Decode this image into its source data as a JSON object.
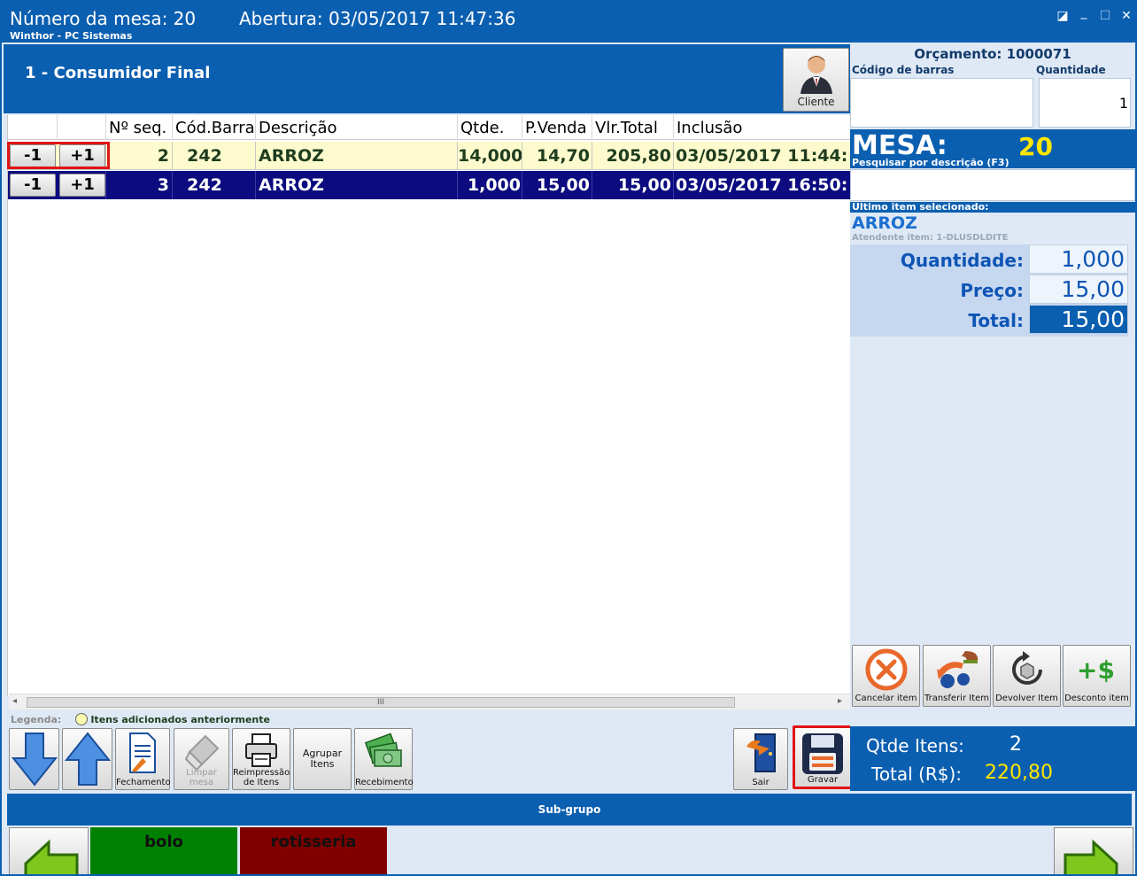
{
  "window": {
    "mesa_title": "Número da mesa: 20",
    "abertura": "Abertura: 03/05/2017 11:47:36",
    "app_name": "Winthor - PC Sistemas"
  },
  "customer": {
    "name": "1 - Consumidor Final",
    "button_label": "Cliente"
  },
  "grid": {
    "columns": [
      "Nº seq.",
      "Cód.Barra",
      "Descrição",
      "Qtde.",
      "P.Venda",
      "Vlr.Total",
      "Inclusão"
    ],
    "minus_label": "-1",
    "plus_label": "+1",
    "rows": [
      {
        "seq": "2",
        "cod": "242",
        "desc": "ARROZ",
        "qtde": "14,000",
        "pvenda": "14,70",
        "vlrtotal": "205,80",
        "inclusao": "03/05/2017 11:44:"
      },
      {
        "seq": "3",
        "cod": "242",
        "desc": "ARROZ",
        "qtde": "1,000",
        "pvenda": "15,00",
        "vlrtotal": "15,00",
        "inclusao": "03/05/2017 16:50:"
      }
    ]
  },
  "legend": {
    "title": "Legenda:",
    "item": "Itens adicionados anteriormente"
  },
  "toolbar": {
    "fechamento": "Fechamento",
    "limpar": "Limpar mesa",
    "reimpressao_1": "Reimpressão",
    "reimpressao_2": "de Itens",
    "agrupar_1": "Agrupar",
    "agrupar_2": "Itens",
    "recebimento": "Recebimento",
    "sair": "Sair",
    "gravar": "Gravar"
  },
  "subgrupo": "Sub-grupo",
  "categories": [
    {
      "label": "bolo",
      "color": "#008000"
    },
    {
      "label": "rotisseria",
      "color": "#800000"
    }
  ],
  "right_panel": {
    "orcamento": "Orçamento: 1000071",
    "cod_barras_label": "Código de barras",
    "quantidade_label": "Quantidade",
    "quantidade_value": "1",
    "mesa_label": "MESA:",
    "mesa_number": "20",
    "pesquisar_label": "Pesquisar por descrição (F3)",
    "ultimo_label": "Último item selecionado:",
    "ultimo_name": "ARROZ",
    "atendente": "Atendente item: 1-DLUSDLDITE",
    "qtd_label": "Quantidade:",
    "qtd_value": "1,000",
    "preco_label": "Preço:",
    "preco_value": "15,00",
    "total_label": "Total:",
    "total_value": "15,00",
    "actions": [
      "Cancelar item",
      "Transferir Item",
      "Devolver Item",
      "Desconto item"
    ],
    "qtde_itens_label": "Qtde Itens:",
    "qtde_itens_value": "2",
    "total_rs_label": "Total (R$):",
    "total_rs_value": "220,80"
  },
  "colors": {
    "primary_blue": "#0b5fb0",
    "selected_row": "#0c0c80",
    "previous_row": "#fdfbcd",
    "highlight_red": "#e01515",
    "mesa_yellow": "#ffe600"
  }
}
